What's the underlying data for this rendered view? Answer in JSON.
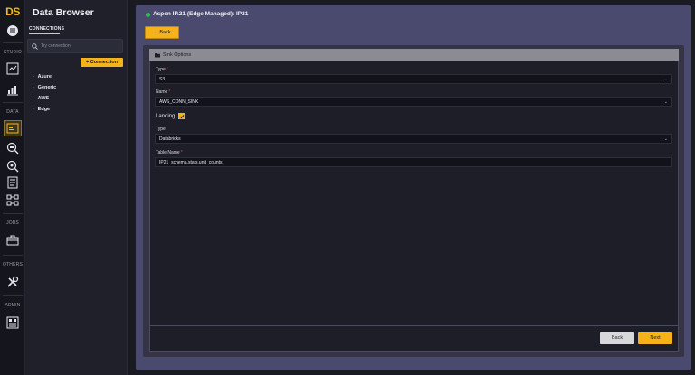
{
  "app": {
    "logo": "DS"
  },
  "rail": {
    "sections": {
      "studio": "STUDIO",
      "data": "DATA",
      "jobs": "JOBS",
      "others": "OTHERS",
      "admin": "ADMIN"
    }
  },
  "browser": {
    "title": "Data Browser",
    "tab": "CONNECTIONS",
    "search_placeholder": "Try connection",
    "add_connection": "+ Connection",
    "tree": [
      "Azure",
      "Generic",
      "AWS",
      "Edge"
    ]
  },
  "header": {
    "title": "Aspen IP.21 (Edge Managed): IP21",
    "status_color": "#2ebd55",
    "back_label": "← Back"
  },
  "form": {
    "section_title": "Sink Options",
    "type_label": "Type",
    "type_value": "S3",
    "name_label": "Name",
    "name_value": "AWS_CONN_SINK",
    "landing_label": "Landing",
    "landing_checked": true,
    "type2_label": "Type",
    "type2_value": "Databricks",
    "table_label": "Table Name",
    "table_value": "IP21_schema.stats.unit_counts",
    "required_mark": "*"
  },
  "footer": {
    "back": "Back",
    "next": "Next"
  },
  "colors": {
    "accent": "#f6b21b",
    "main_bg": "#4a4a6e"
  }
}
